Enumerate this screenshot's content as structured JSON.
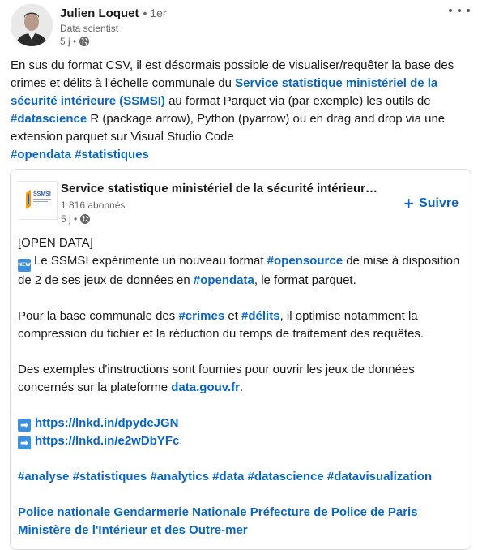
{
  "author": {
    "name": "Julien Loquet",
    "degree": "• 1er",
    "headline": "Data scientist",
    "time": "5 j •"
  },
  "post": {
    "intro": "En sus du format CSV, il est désormais possible de visualiser/requêter la base des crimes et délits à l'échelle communale du ",
    "ssmsi_link": "Service statistique ministériel de la sécurité intérieure (SSMSI)",
    "middle": " au format Parquet via (par exemple) les outils de ",
    "hashtag_datascience": "#datascience",
    "end": " R (package arrow), Python (pyarrow) ou en drag and drop via une extension parquet sur Visual Studio Code",
    "hashtag_opendata": "#opendata",
    "hashtag_statistiques": "#statistiques"
  },
  "shared": {
    "org_name": "Service statistique ministériel de la sécurité intérieur…",
    "followers": "1 816 abonnés",
    "time": "5 j •",
    "follow_label": "Suivre",
    "follow_plus": "+",
    "line_open_data": "[OPEN DATA]",
    "new_badge": "NEW",
    "p1_a": "Le SSMSI expérimente un nouveau format ",
    "p1_tag_opensource": "#opensource",
    "p1_b": " de mise à disposition de 2 de ses jeux de données en ",
    "p1_tag_opendata": "#opendata",
    "p1_c": ", le format parquet.",
    "p2_a": "Pour la base communale des ",
    "p2_tag_crimes": "#crimes",
    "p2_b": " et ",
    "p2_tag_delits": "#délits",
    "p2_c": ", il optimise notamment la compression du fichier et la réduction du temps de traitement des requêtes.",
    "p3_a": "Des exemples d'instructions sont fournies pour ouvrir les jeux de données concernés sur la plateforme ",
    "p3_link": "data.gouv.fr",
    "p3_b": ".",
    "arrow": "➡",
    "link1": "https://lnkd.in/dpydeJGN",
    "link2": "https://lnkd.in/e2wDbYFc",
    "tags": [
      "#analyse",
      "#statistiques",
      "#analytics",
      "#data",
      "#datascience",
      "#datavisualization"
    ],
    "mentions": [
      "Police nationale",
      "Gendarmerie Nationale",
      "Préfecture de Police de Paris",
      "Ministère de l'Intérieur et des Outre-mer"
    ]
  },
  "logo_text": "SSMSI",
  "colors": {
    "link": "#0a66c2",
    "text": "#191919",
    "muted": "#666666"
  }
}
